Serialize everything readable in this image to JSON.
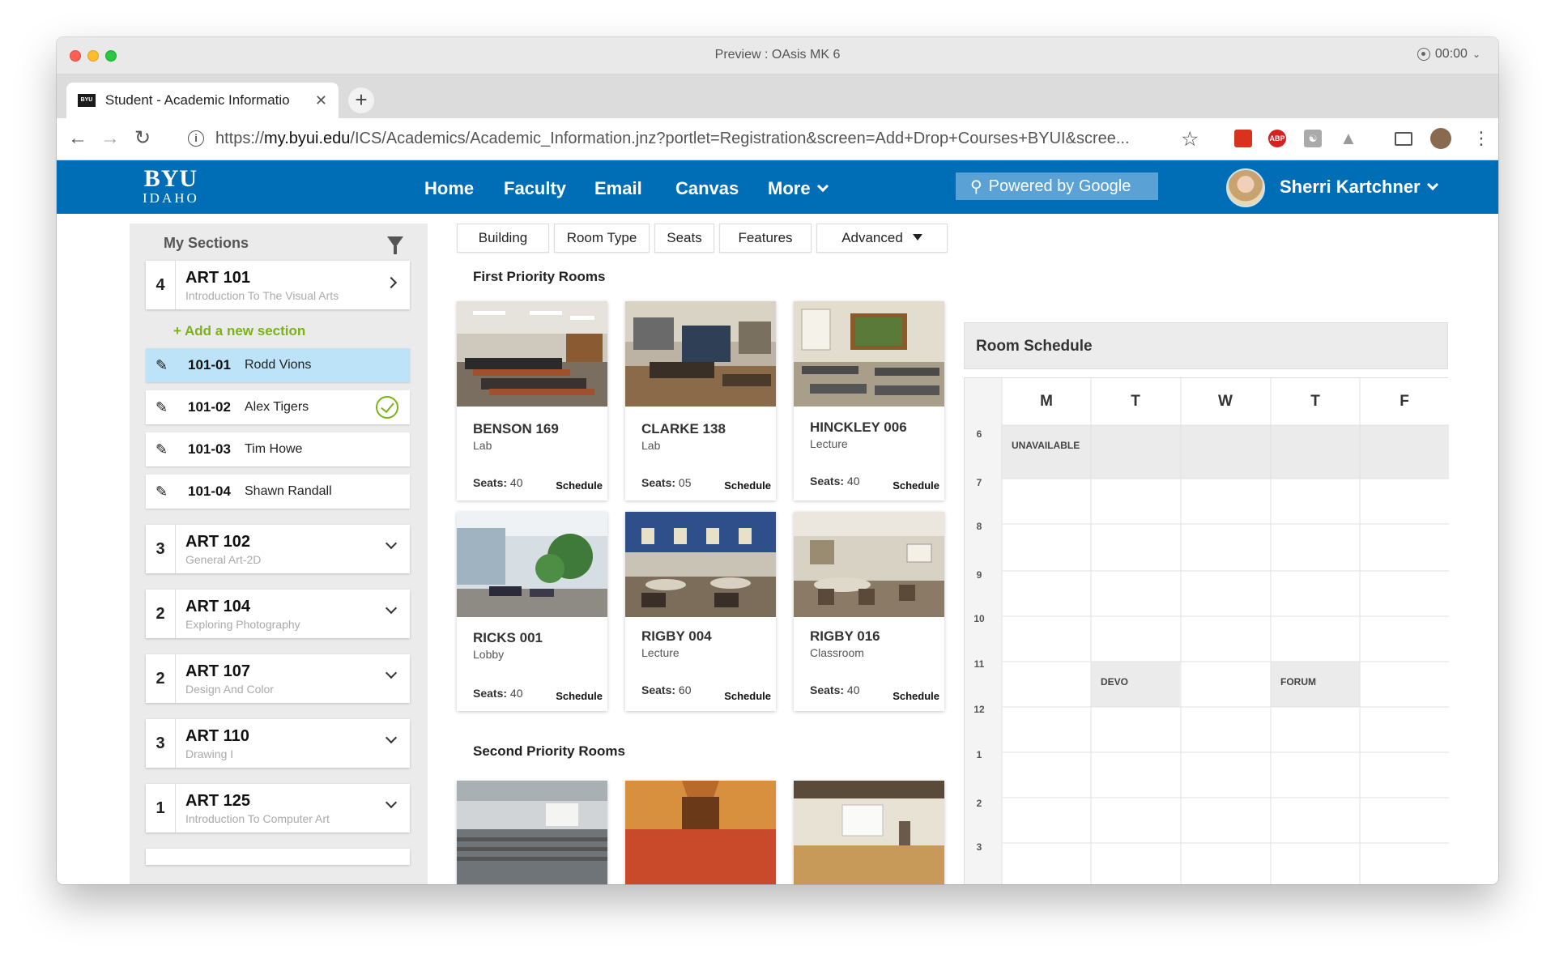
{
  "window": {
    "title": "Preview : OAsis MK 6",
    "recording_time": "00:00"
  },
  "browser": {
    "tab_title": "Student - Academic Informatio",
    "tab_favicon": "BYU",
    "url_prefix": "https://",
    "url_host": "my.byui.edu",
    "url_path": "/ICS/Academics/Academic_Information.jnz?portlet=Registration&screen=Add+Drop+Courses+BYUI&scree..."
  },
  "site": {
    "logo_top": "BYU",
    "logo_bottom": "IDAHO",
    "nav": [
      "Home",
      "Faculty",
      "Email",
      "Canvas",
      "More"
    ],
    "search_placeholder": "Powered by Google",
    "user_name": "Sherri Kartchner",
    "colors": {
      "header": "#006eb6",
      "accent_green": "#7ab317",
      "active_row": "#bde3f8"
    }
  },
  "sidebar": {
    "title": "My Sections",
    "add_section": "+ Add a new section",
    "courses": [
      {
        "count": "4",
        "code": "ART 101",
        "name": "Introduction To The Visual Arts",
        "expanded": true
      },
      {
        "count": "3",
        "code": "ART 102",
        "name": "General Art-2D"
      },
      {
        "count": "2",
        "code": "ART 104",
        "name": "Exploring Photography"
      },
      {
        "count": "2",
        "code": "ART 107",
        "name": "Design And Color"
      },
      {
        "count": "3",
        "code": "ART 110",
        "name": "Drawing I"
      },
      {
        "count": "1",
        "code": "ART 125",
        "name": "Introduction To Computer Art"
      }
    ],
    "sections": [
      {
        "id": "101-01",
        "instructor": "Rodd Vions",
        "active": true
      },
      {
        "id": "101-02",
        "instructor": "Alex Tigers",
        "checked": true
      },
      {
        "id": "101-03",
        "instructor": "Tim Howe"
      },
      {
        "id": "101-04",
        "instructor": "Shawn Randall"
      }
    ]
  },
  "filters": [
    "Building",
    "Room Type",
    "Seats",
    "Features",
    "Advanced"
  ],
  "first_priority": {
    "title": "First Priority Rooms",
    "rooms": [
      {
        "name": "BENSON 169",
        "type": "Lab",
        "seats_label": "Seats:",
        "seats": "40",
        "action": "Schedule"
      },
      {
        "name": "CLARKE 138",
        "type": "Lab",
        "seats_label": "Seats:",
        "seats": "05",
        "action": "Schedule"
      },
      {
        "name": "HINCKLEY 006",
        "type": "Lecture",
        "seats_label": "Seats:",
        "seats": "40",
        "action": "Schedule"
      },
      {
        "name": "RICKS 001",
        "type": "Lobby",
        "seats_label": "Seats:",
        "seats": "40",
        "action": "Schedule"
      },
      {
        "name": "RIGBY 004",
        "type": "Lecture",
        "seats_label": "Seats:",
        "seats": "60",
        "action": "Schedule"
      },
      {
        "name": "RIGBY 016",
        "type": "Classroom",
        "seats_label": "Seats:",
        "seats": "40",
        "action": "Schedule"
      }
    ]
  },
  "second_priority": {
    "title": "Second Priority Rooms"
  },
  "schedule": {
    "title": "Room Schedule",
    "days": [
      "M",
      "T",
      "W",
      "T",
      "F"
    ],
    "hours": [
      "6",
      "7",
      "8",
      "9",
      "10",
      "11",
      "12",
      "1",
      "2",
      "3"
    ],
    "blocks": [
      {
        "label": "UNAVAILABLE"
      },
      {
        "label": "DEVO"
      },
      {
        "label": "FORUM"
      }
    ]
  }
}
